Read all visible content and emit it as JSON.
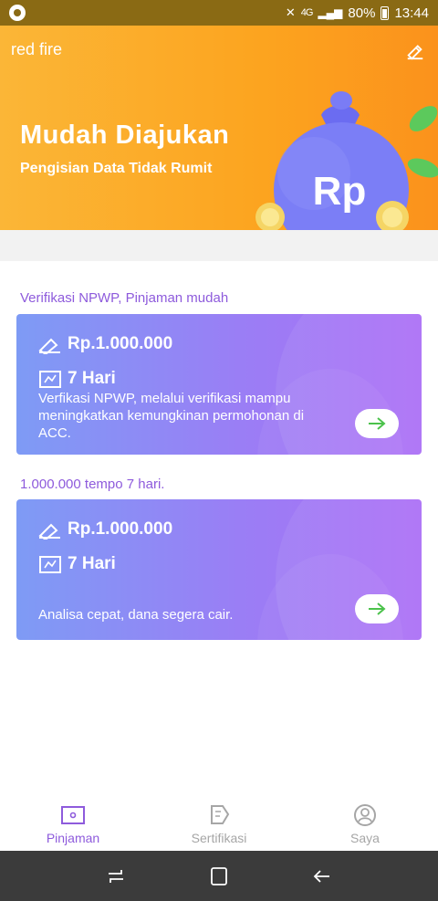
{
  "status_bar": {
    "network": "4G",
    "battery": "80%",
    "time": "13:44"
  },
  "app": {
    "name": "red fire"
  },
  "banner": {
    "title": "Mudah Diajukan",
    "subtitle": "Pengisian Data Tidak Rumit",
    "bag_label": "Rp"
  },
  "sections": [
    {
      "label": "Verifikasi NPWP, Pinjaman mudah",
      "amount": "Rp.1.000.000",
      "term": "7 Hari",
      "description": "Verfikasi NPWP, melalui verifikasi mampu meningkatkan kemungkinan permohonan di ACC."
    },
    {
      "label": "1.000.000 tempo 7 hari.",
      "amount": "Rp.1.000.000",
      "term": "7 Hari",
      "description": "Analisa cepat, dana segera cair."
    }
  ],
  "nav": [
    {
      "label": "Pinjaman",
      "icon": "wallet-icon",
      "active": true
    },
    {
      "label": "Sertifikasi",
      "icon": "certificate-icon",
      "active": false
    },
    {
      "label": "Saya",
      "icon": "user-icon",
      "active": false
    }
  ],
  "colors": {
    "accent": "#8e5bdc",
    "banner": "#fca41f",
    "card_start": "#7e9bf5",
    "card_end": "#ab6ef6"
  }
}
